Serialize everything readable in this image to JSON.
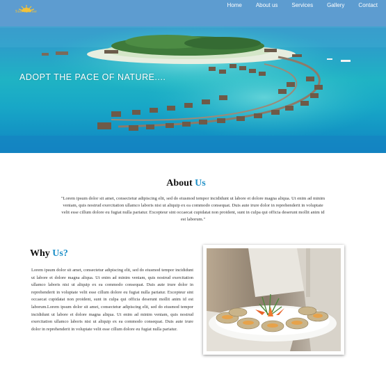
{
  "brand": {
    "logo_text": "Sun sunrise",
    "logo_color": "#f2c23a"
  },
  "nav": [
    {
      "label": "Home"
    },
    {
      "label": "About us"
    },
    {
      "label": "Services"
    },
    {
      "label": "Gallery"
    },
    {
      "label": "Contact"
    }
  ],
  "hero": {
    "tagline": "ADOPT THE PACE OF NATURE...."
  },
  "about": {
    "title_main": "About",
    "title_accent": "Us",
    "text": "\"Lorem ipsum dolor sit amet, consectetur adipiscing elit, sed do eiusmod tempor incididunt ut labore et dolore magna aliqua. Ut enim ad minim veniam, quis nostrud exercitation ullamco laboris nisi ut aliquip ex ea commodo consequat. Duis aute irure dolor in reprehenderit in voluptate velit esse cillum dolore eu fugiat nulla pariatur. Excepteur sint occaecat cupidatat non proident, sunt in culpa qui officia deserunt mollit anim id est laborum.\""
  },
  "why": {
    "title_main": "Why",
    "title_accent": "Us?",
    "text": "Lorem ipsum dolor sit amet, consectetur adipiscing elit, sed do eiusmod tempor incididunt ut labore et dolore magna aliqua. Ut enim ad minim veniam, quis nostrud exercitation ullamco laboris nisi ut aliquip ex ea commodo consequat. Duis aute irure dolor in reprehenderit in voluptate velit esse cillum dolore eu fugiat nulla pariatur. Excepteur sint occaecat cupidatat non proident, sunt in culpa qui officia deserunt mollit anim id est laborum.Lorem ipsum dolor sit amet, consectetur adipiscing elit, sed do eiusmod tempor incididunt ut labore et dolore magna aliqua. Ut enim ad minim veniam, quis nostrud exercitation ullamco laboris nisi ut aliquip ex ea commodo consequat. Duis aute irure dolor in reprehenderit in voluptate velit esse cillum dolore eu fugiat nulla pariatur."
  },
  "colors": {
    "accent": "#1e90c8",
    "nav_text": "#ffffff"
  }
}
